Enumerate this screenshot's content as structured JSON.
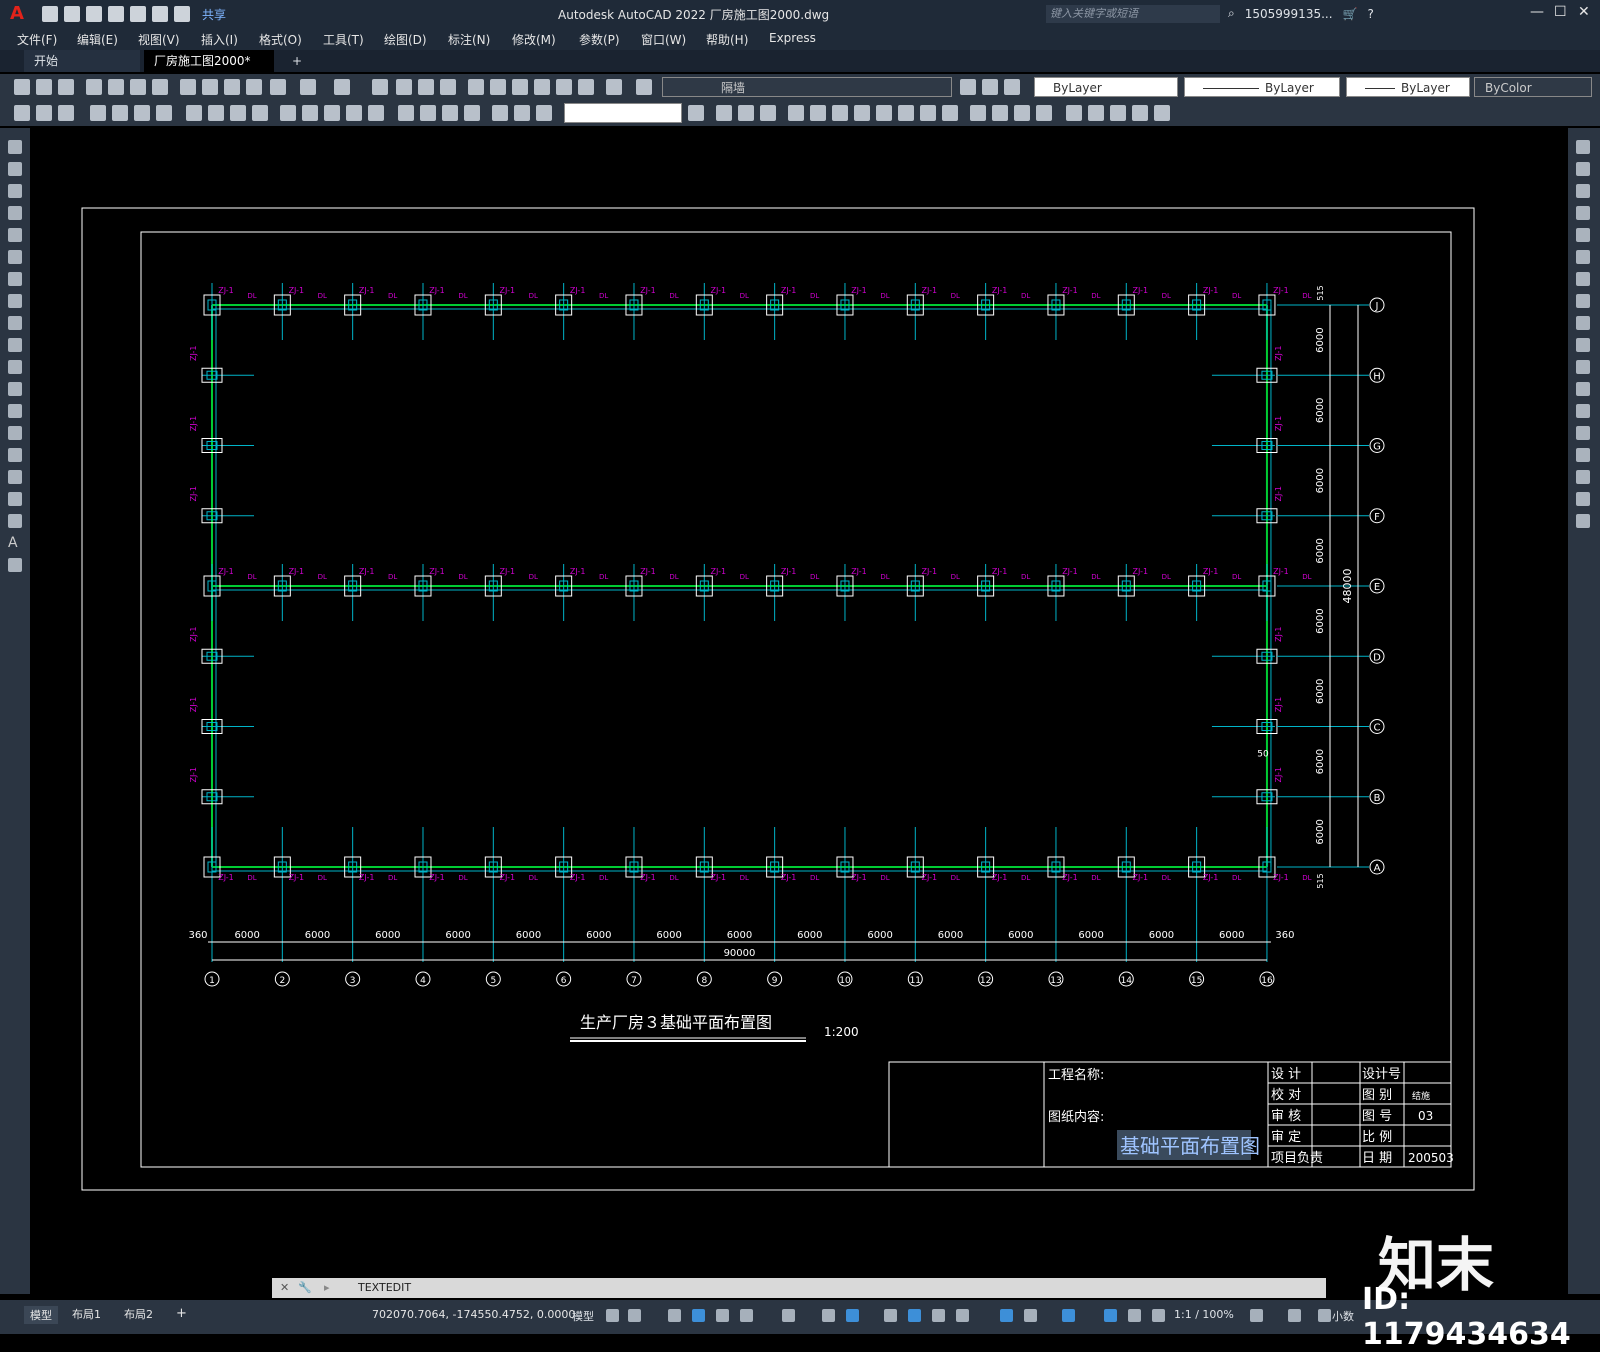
{
  "titlebar": {
    "share": "共享",
    "title": "Autodesk AutoCAD 2022    厂房施工图2000.dwg",
    "search_placeholder": "键入关键字或短语",
    "user": "1505999135...",
    "minimize": "—",
    "restore": "☐",
    "close": "✕"
  },
  "menu": [
    "文件(F)",
    "编辑(E)",
    "视图(V)",
    "插入(I)",
    "格式(O)",
    "工具(T)",
    "绘图(D)",
    "标注(N)",
    "修改(M)",
    "参数(P)",
    "窗口(W)",
    "帮助(H)",
    "Express"
  ],
  "file_tabs": {
    "start": "开始",
    "active": "厂房施工图2000*",
    "close": "✕",
    "add": "+"
  },
  "toolbar": {
    "layer": "隔墙",
    "color": "ByLayer",
    "linetype": "ByLayer",
    "lineweight": "ByLayer",
    "plotstyle": "ByColor"
  },
  "drawing": {
    "title": "生产厂房３基础平面布置图",
    "scale": "1:200",
    "column_labels": [
      "1",
      "2",
      "3",
      "4",
      "5",
      "6",
      "7",
      "8",
      "9",
      "10",
      "11",
      "12",
      "13",
      "14",
      "15",
      "16"
    ],
    "row_labels": [
      "J",
      "H",
      "G",
      "F",
      "E",
      "D",
      "C",
      "B",
      "A"
    ],
    "bay_dim": "6000",
    "end_dim": "360",
    "total_x": "90000",
    "total_y": "48000",
    "edge_dim": "515",
    "offset_dim": "50",
    "footing_tag": "ZJ-1",
    "beam_tag": "DL"
  },
  "title_block": {
    "project_name": "工程名称:",
    "drawing_content": "图纸内容:",
    "content_value": "基础平面布置图",
    "design": "设  计",
    "check": "校  对",
    "review": "审  核",
    "approve": "审  定",
    "lead": "项目负责",
    "design_no": "设计号",
    "category": "图  别",
    "category_value": "结施",
    "drawing_no": "图  号",
    "drawing_no_value": "03",
    "scale_label": "比  例",
    "date_label": "日  期",
    "date_value": "200503"
  },
  "command": {
    "text": "TEXTEDIT"
  },
  "layout_tabs": [
    "模型",
    "布局1",
    "布局2"
  ],
  "layout_add": "+",
  "status": {
    "coords": "702070.7064, -174550.4752, 0.0000",
    "model": "模型",
    "scale": "1:1 / 100%",
    "units": "小数"
  },
  "watermark": {
    "brand": "知末",
    "id": "ID: 1179434634"
  },
  "colors": {
    "cyan": "#00b4c8",
    "green": "#00cc33",
    "magenta": "#d000d0",
    "white": "#ffffff",
    "chrome": "#2b3542"
  }
}
